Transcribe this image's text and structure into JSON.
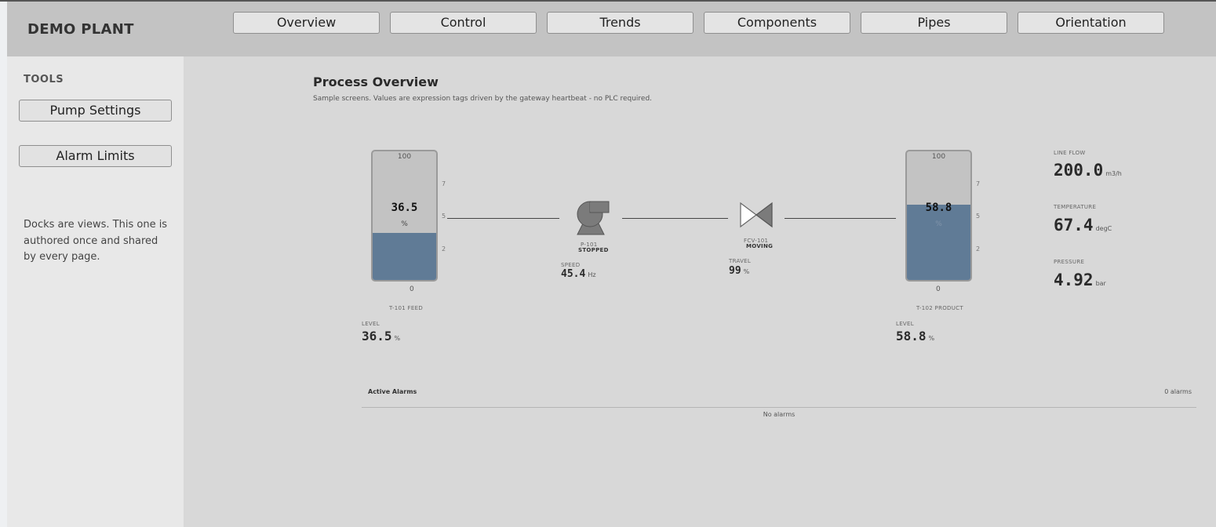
{
  "app": {
    "title": "DEMO PLANT"
  },
  "nav": {
    "tabs": [
      "Overview",
      "Control",
      "Trends",
      "Components",
      "Pipes",
      "Orientation"
    ]
  },
  "sidebar": {
    "title": "TOOLS",
    "buttons": [
      "Pump Settings",
      "Alarm Limits"
    ],
    "note": "Docks are views. This one is authored once and shared by every page."
  },
  "overview": {
    "title": "Process Overview",
    "subtitle": "Sample screens. Values are expression tags driven by the gateway heartbeat - no PLC required."
  },
  "tanks": [
    {
      "name": "T-101 FEED",
      "max": "100",
      "min": "0",
      "value": "36.5",
      "unit": "%",
      "level_percent": 36.5,
      "ticks": [
        "7",
        "5",
        "2"
      ],
      "readout_label": "LEVEL",
      "readout_value": "36.5",
      "readout_unit": "%"
    },
    {
      "name": "T-102 PRODUCT",
      "max": "100",
      "min": "0",
      "value": "58.8",
      "unit": "%",
      "level_percent": 58.8,
      "ticks": [
        "7",
        "5",
        "2"
      ],
      "readout_label": "LEVEL",
      "readout_value": "58.8",
      "readout_unit": "%"
    }
  ],
  "pump": {
    "tag": "P-101",
    "state": "STOPPED",
    "metric_label": "SPEED",
    "metric_value": "45.4",
    "metric_unit": "Hz"
  },
  "valve": {
    "tag": "FCV-101",
    "state": "MOVING",
    "metric_label": "TRAVEL",
    "metric_value": "99",
    "metric_unit": "%"
  },
  "metrics": [
    {
      "label": "LINE FLOW",
      "value": "200.0",
      "unit": "m3/h"
    },
    {
      "label": "TEMPERATURE",
      "value": "67.4",
      "unit": "degC"
    },
    {
      "label": "PRESSURE",
      "value": "4.92",
      "unit": "bar"
    }
  ],
  "alarms": {
    "title": "Active Alarms",
    "count": "0 alarms",
    "empty": "No alarms"
  },
  "colors": {
    "header": "#c3c3c3",
    "sidebar": "#e8e8e8",
    "main": "#d8d8d8",
    "tank_fill": "#607b96",
    "tank_empty": "#c3c3c3"
  },
  "icons": {
    "pump": "centrifugal-pump-icon",
    "valve": "butterfly-valve-icon"
  }
}
